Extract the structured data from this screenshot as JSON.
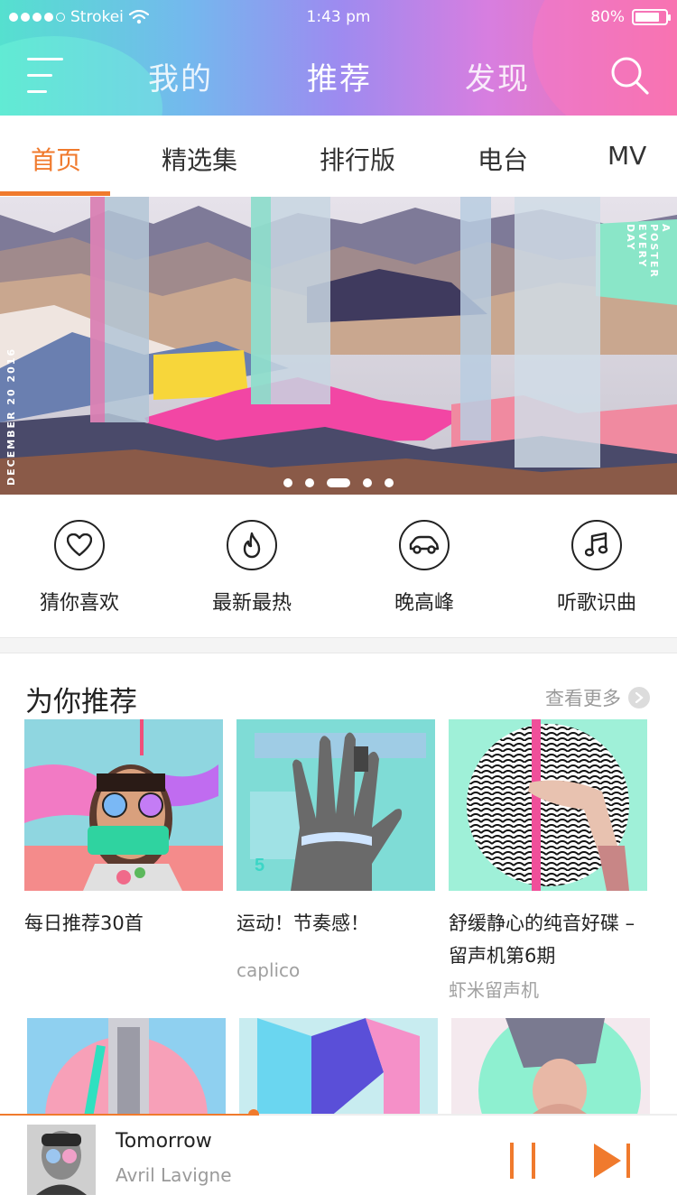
{
  "status_bar": {
    "carrier": "Strokei",
    "time": "1:43 pm",
    "battery": "80%",
    "battery_level": 0.8
  },
  "nav": {
    "tabs": [
      {
        "label": "我的"
      },
      {
        "label": "推荐"
      },
      {
        "label": "发现"
      }
    ],
    "active_tab": "推荐"
  },
  "subtabs": {
    "items": [
      {
        "label": "首页"
      },
      {
        "label": "精选集"
      },
      {
        "label": "排行版"
      },
      {
        "label": "电台"
      },
      {
        "label": "MV"
      }
    ],
    "active": "首页"
  },
  "banner": {
    "side_left": "DECEMBER 20 2016",
    "side_right": "A POSTER EVERY DAY",
    "page_count": 5,
    "active_page": 3
  },
  "quick_links": [
    {
      "label": "猜你喜欢",
      "icon": "heart-icon"
    },
    {
      "label": "最新最热",
      "icon": "flame-icon"
    },
    {
      "label": "晚高峰",
      "icon": "car-icon"
    },
    {
      "label": "听歌识曲",
      "icon": "music-note-icon"
    }
  ],
  "recommend": {
    "title": "为你推荐",
    "more": "查看更多",
    "cards": [
      {
        "title": "每日推荐30首",
        "subtitle": ""
      },
      {
        "title": "运动！节奏感！",
        "subtitle": "caplico"
      },
      {
        "title": "舒缓静心的纯音好碟 – 留声机第6期",
        "subtitle": "虾米留声机"
      }
    ]
  },
  "player": {
    "song": "Tomorrow",
    "artist": "Avril Lavigne",
    "progress": 0.375
  },
  "colors": {
    "accent": "#f07a2d",
    "header_start": "#55e0cf",
    "header_end": "#f36fa6"
  }
}
